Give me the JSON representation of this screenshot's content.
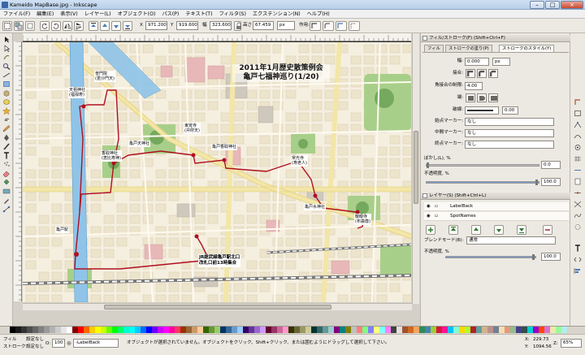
{
  "window": {
    "title": "Kameido MapBase.jpg - Inkscape",
    "buttons": [
      "–",
      "□",
      "×"
    ]
  },
  "menu": [
    "ファイル(F)",
    "編集(E)",
    "表示(V)",
    "レイヤー(L)",
    "オブジェクト(O)",
    "パス(P)",
    "テキスト(T)",
    "フィルタ(S)",
    "エクステンション(N)",
    "ヘルプ(H)"
  ],
  "controls": {
    "x_label": "X",
    "x_value": "971.200",
    "y_label": "Y",
    "y_value": "919.600",
    "w_label": "幅",
    "w_value": "323.600",
    "h_label": "高さ",
    "h_value": "67.459",
    "unit": "px",
    "action_label": "作用:"
  },
  "map": {
    "title_line1": "2011年1月歴史散策例会",
    "title_line2": "亀戸七福神巡り(1/20)",
    "labels": [
      {
        "text": "普門院",
        "sub": "(毘沙門天)"
      },
      {
        "text": "東覚寺",
        "sub": "(弁財天)"
      },
      {
        "text": "亀戸天神社",
        "sub": ""
      },
      {
        "text": "常光寺",
        "sub": "(寿老人)"
      },
      {
        "text": "亀戸香取神社",
        "sub": ""
      },
      {
        "text": "天祖神社",
        "sub": "(福禄寿)"
      },
      {
        "text": "香取神社",
        "sub": "(恵比寿神)"
      },
      {
        "text": "亀戸駅",
        "sub": ""
      },
      {
        "text": "亀戸水神社",
        "sub": ""
      },
      {
        "text": "龍眼寺",
        "sub": "(布袋尊)"
      },
      {
        "text": "JR総武線亀戸駅北口",
        "sub": "集合 13時"
      }
    ],
    "start_label": "JR総武線亀戸駅北口",
    "start_sub": "改札口前13時集合"
  },
  "dock": {
    "fill_stroke_title": "フィル/ストローク(F) (Shift+Ctrl+F)",
    "tabs": [
      "フィル",
      "ストロークの塗り(P)",
      "ストロークのスタイル(Y)"
    ],
    "width_label": "幅:",
    "width_value": "0.000",
    "width_unit": "px",
    "join_label": "接合:",
    "miter_label": "角接合の制限:",
    "miter_value": "4.00",
    "cap_label": "端:",
    "dash_label": "破線:",
    "dash_value": "0.00",
    "start_marker_label": "始点マーカー:",
    "start_marker_value": "なし",
    "mid_marker_label": "中間マーカー:",
    "mid_marker_value": "なし",
    "end_marker_label": "終点マーカー:",
    "end_marker_value": "なし",
    "blur_label": "ぼかし(L), %",
    "blur_value": "0.0",
    "opacity_label": "不透明度, %",
    "opacity_value": "100.0",
    "layers_title": "レイヤー(S) (Shift+Ctrl+L)",
    "layers": [
      "LabelBack",
      "SpotNames"
    ],
    "blend_label": "ブレンドモード(B):",
    "blend_value": "通常",
    "layer_opacity_label": "不透明度, %",
    "layer_opacity_value": "100.0"
  },
  "status": {
    "fill_label": "フィル",
    "fill_value": "設定なし",
    "stroke_label": "ストローク",
    "stroke_value": "設定なし",
    "opacity_label": "O:",
    "opacity_value": "100",
    "layer_value": "-LabelBack",
    "message": "オブジェクトが選択されていません。オブジェクトをクリック、Shift+クリック、または囲むようにドラッグして選択して下さい。",
    "x_label": "X:",
    "x_value": "229.73",
    "y_label": "Y:",
    "y_value": "1094.56",
    "zoom_label": "Z:",
    "zoom_value": "65%"
  },
  "colors": {
    "route": "#b01020",
    "river": "#8fc4e8",
    "park": "#4a8a3a",
    "road": "#f2e6a8"
  }
}
